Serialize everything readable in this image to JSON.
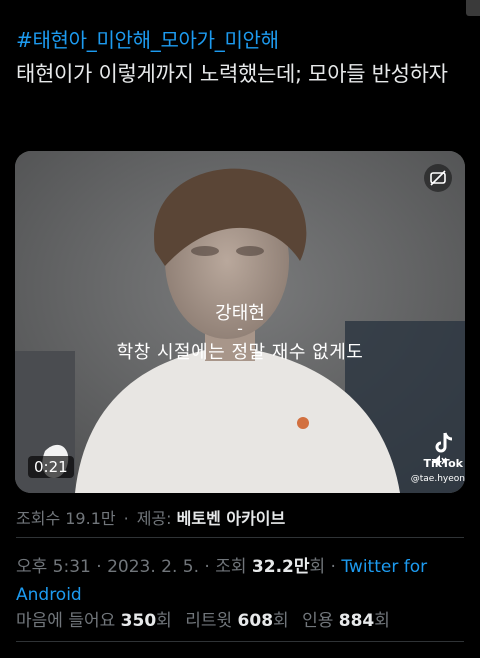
{
  "tweet": {
    "hashtag": "#태현아_미안해_모아가_미안해",
    "text": "태현이가 이렇게까지 노력했는데; 모아들 반성하자"
  },
  "video": {
    "caption_name": "강태현",
    "caption_dash": "-",
    "caption_sub": "학창 시절에는 정말 재수 없게도",
    "duration": "0:21",
    "watermark_brand": "TikTok",
    "watermark_handle": "@tae.hyeon"
  },
  "views": {
    "label": "조회수 19.1만",
    "separator": "·",
    "source_label": "제공:",
    "source_name": "베토벤 아카이브"
  },
  "meta": {
    "time": "오후 5:31",
    "sep1": " · ",
    "date": "2023. 2. 5.",
    "sep2": " · ",
    "views_prefix": "조회 ",
    "views_count": "32.2만",
    "views_suffix": "회",
    "sep3": " · ",
    "client": "Twitter for Android"
  },
  "stats": {
    "likes_label": "마음에 들어요",
    "likes_count": "350",
    "likes_unit": "회",
    "retweets_label": "리트윗",
    "retweets_count": "608",
    "retweets_unit": "회",
    "quotes_label": "인용",
    "quotes_count": "884",
    "quotes_unit": "회"
  },
  "colors": {
    "background": "#000000",
    "link": "#1d9bf0",
    "text": "#e7e9ea",
    "muted": "#71767b"
  }
}
